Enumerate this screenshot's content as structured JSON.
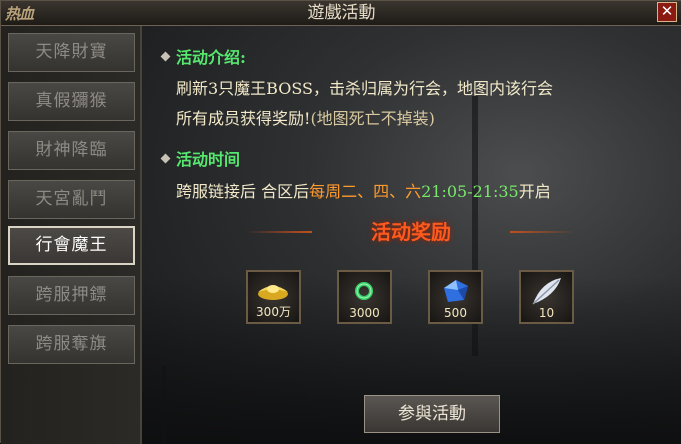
{
  "window": {
    "title": "遊戲活動",
    "close_label": "✕",
    "logo": "热血"
  },
  "sidebar": {
    "items": [
      {
        "label": "天降財寶",
        "active": false
      },
      {
        "label": "真假獼猴",
        "active": false
      },
      {
        "label": "財神降臨",
        "active": false
      },
      {
        "label": "天宮亂鬥",
        "active": false
      },
      {
        "label": "行會魔王",
        "active": true
      },
      {
        "label": "跨服押鏢",
        "active": false
      },
      {
        "label": "跨服奪旗",
        "active": false
      }
    ]
  },
  "main": {
    "intro_title": "活动介绍:",
    "intro_line1": "刷新3只魔王BOSS，击杀归属为行会，地图内该行会",
    "intro_line2": "所有成员获得奖励!",
    "intro_line2_note": "(地图死亡不掉装)",
    "time_title": "活动时间",
    "time_prefix": "跨服链接后 合区后",
    "time_days": "每周二、四、六",
    "time_range": "21:05-21:35",
    "time_suffix": "开启",
    "reward_title": "活动奖励",
    "rewards": [
      {
        "icon": "gold-ingot-icon",
        "count": "300万"
      },
      {
        "icon": "jade-ring-icon",
        "count": "3000"
      },
      {
        "icon": "blue-gem-icon",
        "count": "500"
      },
      {
        "icon": "feather-icon",
        "count": "10"
      }
    ],
    "join_label": "参與活動"
  },
  "colors": {
    "section_title": "#56e86e",
    "reward_title": "#ff5a1e",
    "days": "#ff9a2e",
    "time": "#78e86a"
  }
}
